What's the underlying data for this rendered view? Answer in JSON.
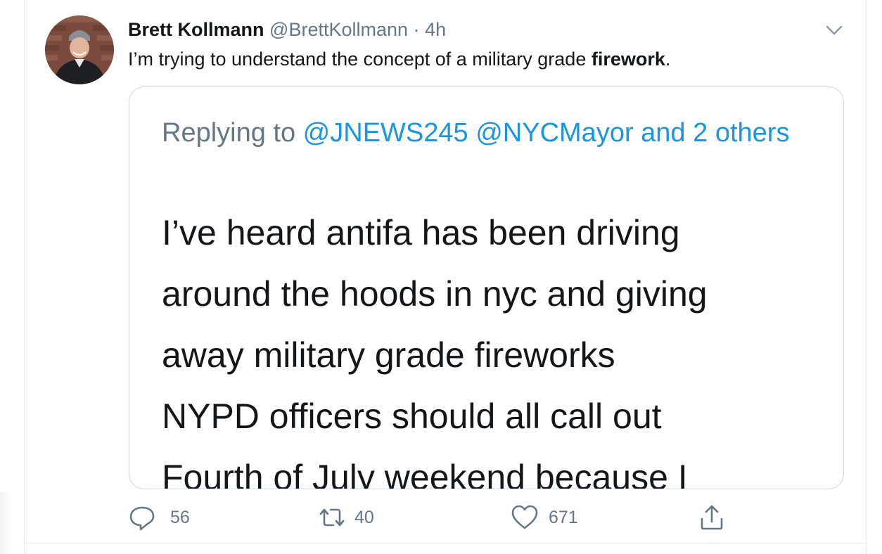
{
  "tweet": {
    "author_name": "Brett Kollmann",
    "handle": "@BrettKollmann",
    "separator": "·",
    "time": "4h",
    "text_before": "I’m trying to understand the concept of a military grade ",
    "text_bold": "firework",
    "text_after": "."
  },
  "quoted": {
    "replying_prefix": "Replying to ",
    "mention_1": "@JNEWS245",
    "mention_2": "@NYCMayor",
    "mention_and": " and 2",
    "mention_others": "others",
    "lines": [
      "I’ve heard antifa has been driving",
      "around the hoods in nyc and giving",
      "away military grade fireworks",
      "NYPD officers should all call out",
      "Fourth of July weekend because I"
    ]
  },
  "actions": {
    "replies": "56",
    "retweets": "40",
    "likes": "671"
  },
  "icons": {
    "reply": "reply-icon",
    "retweet": "retweet-icon",
    "like": "heart-icon",
    "share": "share-icon",
    "menu": "chevron-down-icon"
  },
  "colors": {
    "text": "#14171a",
    "secondary": "#657786",
    "link": "#1b95e0",
    "border": "#ccd6dd"
  }
}
